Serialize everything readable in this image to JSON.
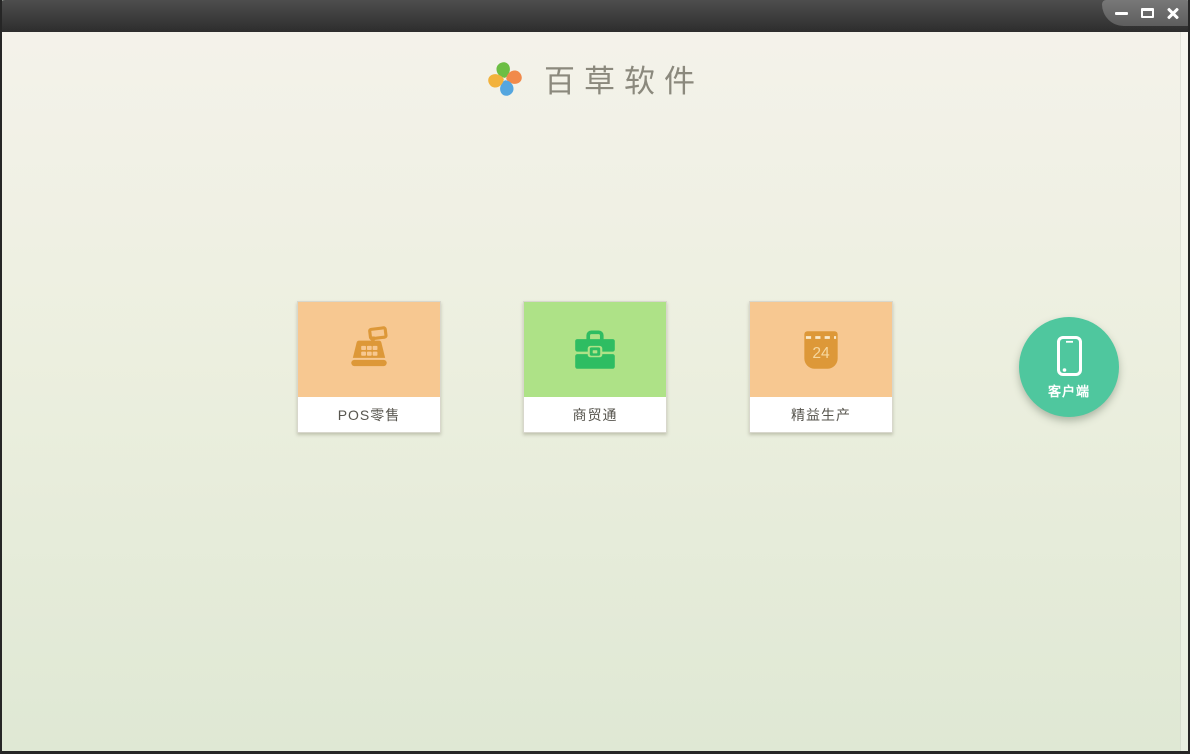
{
  "window": {
    "controls": [
      {
        "name": "minimize"
      },
      {
        "name": "maximize"
      },
      {
        "name": "close"
      }
    ]
  },
  "header": {
    "app_name": "百草软件",
    "logo_icon": "pinwheel-icon"
  },
  "products": [
    {
      "label": "POS零售",
      "icon": "cash-register-icon",
      "theme": "orange"
    },
    {
      "label": "商贸通",
      "icon": "briefcase-icon",
      "theme": "green"
    },
    {
      "label": "精益生产",
      "icon": "calendar-icon",
      "theme": "orange",
      "calendar_day": "24"
    }
  ],
  "client_button": {
    "label": "客户端",
    "icon": "smartphone-icon"
  },
  "colors": {
    "window_border": "#262626",
    "title_bar_top": "#4e4e4e",
    "title_bar_bottom": "#2d2d2d",
    "controls_tab_top": "#787878",
    "controls_tab_bottom": "#5e5e5e",
    "bg_top": "#f4f2ea",
    "bg_mid": "#ecefdf",
    "bg_bottom": "#dfe8d4",
    "logo_text": "#8b897d",
    "label_text": "#57554e",
    "card_orange_bg": "#f7c891",
    "card_orange_icon": "#dd9838",
    "card_green_bg": "#aee287",
    "card_green_icon": "#2ebd62",
    "calendar_day_color": "#f6d79e",
    "client_teal": "#4fc79e",
    "petal_green": "#6cbe44",
    "petal_orange": "#f18a4b",
    "petal_blue": "#54a6df",
    "petal_yellow": "#f2b23c"
  }
}
